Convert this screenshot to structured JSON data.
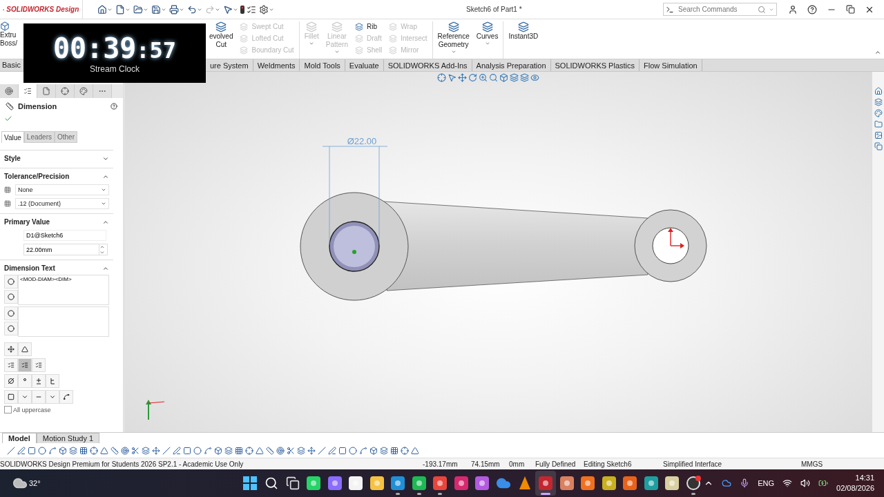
{
  "app": {
    "brand": "SOLIDWORKS Design",
    "document_title": "Sketch6 of Part1 *",
    "search": {
      "placeholder": "Search Commands"
    }
  },
  "clock": {
    "time": "00:39",
    "seconds": ":57",
    "label": "Stream Clock"
  },
  "ribbon": {
    "hidden_left": [
      "Extru",
      "Boss/"
    ],
    "items": [
      {
        "kind": "large",
        "lines": [
          "evolved",
          "Cut"
        ],
        "disabled": false,
        "dropdown": false
      },
      {
        "kind": "stack",
        "rows": [
          {
            "label": "Swept Cut",
            "disabled": true
          },
          {
            "label": "Lofted Cut",
            "disabled": true
          },
          {
            "label": "Boundary Cut",
            "disabled": true
          }
        ]
      },
      {
        "kind": "divider"
      },
      {
        "kind": "large",
        "lines": [
          "Fillet"
        ],
        "disabled": true,
        "dropdown": true
      },
      {
        "kind": "large",
        "lines": [
          "Linear",
          "Pattern"
        ],
        "disabled": true,
        "dropdown": true
      },
      {
        "kind": "stack",
        "rows": [
          {
            "label": "Rib",
            "disabled": false
          },
          {
            "label": "Draft",
            "disabled": true
          },
          {
            "label": "Shell",
            "disabled": true
          }
        ]
      },
      {
        "kind": "stack",
        "rows": [
          {
            "label": "Wrap",
            "disabled": true
          },
          {
            "label": "Intersect",
            "disabled": true
          },
          {
            "label": "Mirror",
            "disabled": true
          }
        ]
      },
      {
        "kind": "divider"
      },
      {
        "kind": "large",
        "lines": [
          "Reference",
          "Geometry"
        ],
        "disabled": false,
        "dropdown": true
      },
      {
        "kind": "large",
        "lines": [
          "Curves"
        ],
        "disabled": false,
        "dropdown": true
      },
      {
        "kind": "divider"
      },
      {
        "kind": "large",
        "lines": [
          "Instant3D"
        ],
        "disabled": false,
        "dropdown": false
      }
    ]
  },
  "command_tabs": {
    "hidden_left": "Basic",
    "tabs": [
      {
        "label": "ure System",
        "selected": false
      },
      {
        "label": "Weldments",
        "selected": false
      },
      {
        "label": "Mold Tools",
        "selected": false
      },
      {
        "label": "Evaluate",
        "selected": false
      },
      {
        "label": "SOLIDWORKS Add-Ins",
        "selected": false
      },
      {
        "label": "Analysis Preparation",
        "selected": false
      },
      {
        "label": "SOLIDWORKS Plastics",
        "selected": false
      },
      {
        "label": "Flow Simulation",
        "selected": false
      }
    ]
  },
  "panel": {
    "icon_tabs": [
      {
        "selected": false
      },
      {
        "selected": true
      },
      {
        "selected": false
      },
      {
        "selected": false
      },
      {
        "selected": false
      },
      {
        "selected": false
      }
    ],
    "title": "Dimension",
    "tabs": [
      {
        "label": "Value",
        "selected": true
      },
      {
        "label": "Leaders",
        "selected": false
      },
      {
        "label": "Other",
        "selected": false
      }
    ],
    "style": {
      "title": "Style",
      "expanded": false
    },
    "tolerance": {
      "title": "Tolerance/Precision",
      "expanded": true,
      "tolerance_type": "None",
      "precision": ".12 (Document)"
    },
    "primary_value": {
      "title": "Primary Value",
      "expanded": true,
      "name": "D1@Sketch6",
      "value": "22.00mm"
    },
    "dimension_text": {
      "title": "Dimension Text",
      "expanded": true,
      "above": "<MOD-DIAM><DIM>",
      "justify": [
        {
          "selected": false
        },
        {
          "selected": true
        },
        {
          "selected": false
        }
      ],
      "all_uppercase": {
        "label": "All uppercase",
        "checked": false
      }
    }
  },
  "viewport": {
    "dimension_label": "Ø22.00"
  },
  "bottom_tabs": [
    {
      "label": "Model",
      "selected": true
    },
    {
      "label": "Motion Study 1",
      "selected": false
    }
  ],
  "status": {
    "product": "SOLIDWORKS Design Premium for Students 2026 SP2.1 - Academic Use Only",
    "x": "-193.17mm",
    "y": "74.15mm",
    "z": "0mm",
    "state": "Fully Defined",
    "mode": "Editing Sketch6",
    "interface": "Simplified Interface",
    "units": "MMGS"
  },
  "taskbar": {
    "temperature": "32°",
    "language": "ENG",
    "time": "14:31",
    "date": "02/08/2026",
    "apps": [
      {
        "kind": "start",
        "running": false,
        "active": false
      },
      {
        "kind": "search",
        "running": false,
        "active": false
      },
      {
        "kind": "taskview",
        "running": false,
        "active": false
      },
      {
        "kind": "chat",
        "running": false,
        "active": false
      },
      {
        "kind": "assistant",
        "running": false,
        "active": false
      },
      {
        "kind": "store",
        "running": false,
        "active": false
      },
      {
        "kind": "folder",
        "running": false,
        "active": false
      },
      {
        "kind": "browser",
        "running": true,
        "active": false
      },
      {
        "kind": "music",
        "running": true,
        "active": false
      },
      {
        "kind": "browser2",
        "running": true,
        "active": false
      },
      {
        "kind": "camera",
        "running": false,
        "active": false
      },
      {
        "kind": "office",
        "running": false,
        "active": false
      },
      {
        "kind": "cloud",
        "running": false,
        "active": false
      },
      {
        "kind": "cone",
        "running": false,
        "active": false
      },
      {
        "kind": "cad",
        "running": true,
        "active": true
      },
      {
        "kind": "burst",
        "running": false,
        "active": false
      },
      {
        "kind": "orange",
        "running": false,
        "active": false
      },
      {
        "kind": "yellow",
        "running": false,
        "active": false
      },
      {
        "kind": "orange2",
        "running": false,
        "active": false
      },
      {
        "kind": "teal",
        "running": false,
        "active": false
      },
      {
        "kind": "board",
        "running": false,
        "active": false
      },
      {
        "kind": "record",
        "running": true,
        "active": false
      }
    ]
  }
}
